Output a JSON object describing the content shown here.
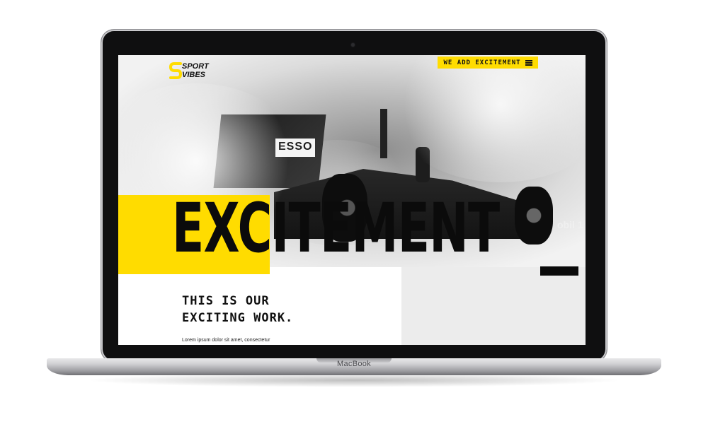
{
  "device": {
    "brand_label": "MacBook"
  },
  "site": {
    "logo": {
      "line1": "SPORT",
      "line2": "VIBES"
    },
    "menu_button": {
      "label": "WE ADD EXCITEMENT",
      "icon": "hamburger-menu-icon"
    },
    "hero": {
      "headline": "EXCITEMENT",
      "car_livery_text": "ESSO",
      "car_side_text": "obil 1"
    },
    "intro": {
      "heading_line1": "THIS IS OUR",
      "heading_line2": "EXCITING WORK.",
      "body": "Lorem ipsum dolor sit amet, consectetur"
    }
  },
  "colors": {
    "accent": "#ffdc00",
    "ink": "#0b0b0b",
    "panel_grey": "#ececec"
  }
}
